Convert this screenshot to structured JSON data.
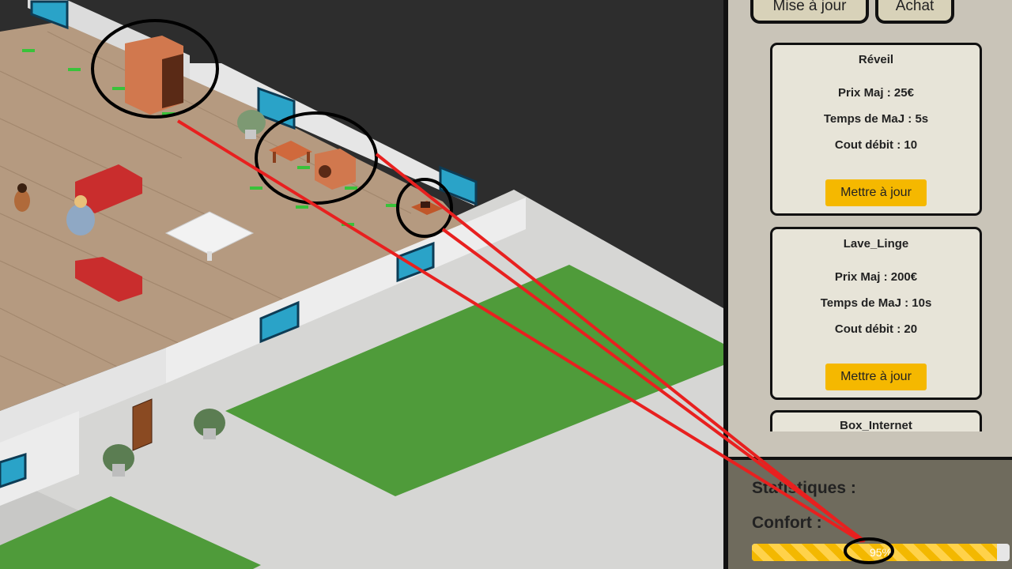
{
  "panel": {
    "buttons": {
      "update": "Mise à jour",
      "purchase": "Achat"
    },
    "items": [
      {
        "name": "Réveil",
        "price": "Prix Maj : 25€",
        "time": "Temps de MaJ : 5s",
        "cost": "Cout débit : 10",
        "action": "Mettre à jour"
      },
      {
        "name": "Lave_Linge",
        "price": "Prix Maj : 200€",
        "time": "Temps de MaJ : 10s",
        "cost": "Cout débit : 20",
        "action": "Mettre à jour"
      },
      {
        "name": "Box_Internet"
      }
    ]
  },
  "stats": {
    "title": "Statistiques :",
    "comfort_label": "Confort :",
    "comfort_value": "95%",
    "comfort_fraction": 0.95
  },
  "colors": {
    "accent": "#f5b800",
    "panel": "#c9c4b8",
    "stats_bg": "#6f6b5d",
    "annotation_line": "#e8201f"
  }
}
